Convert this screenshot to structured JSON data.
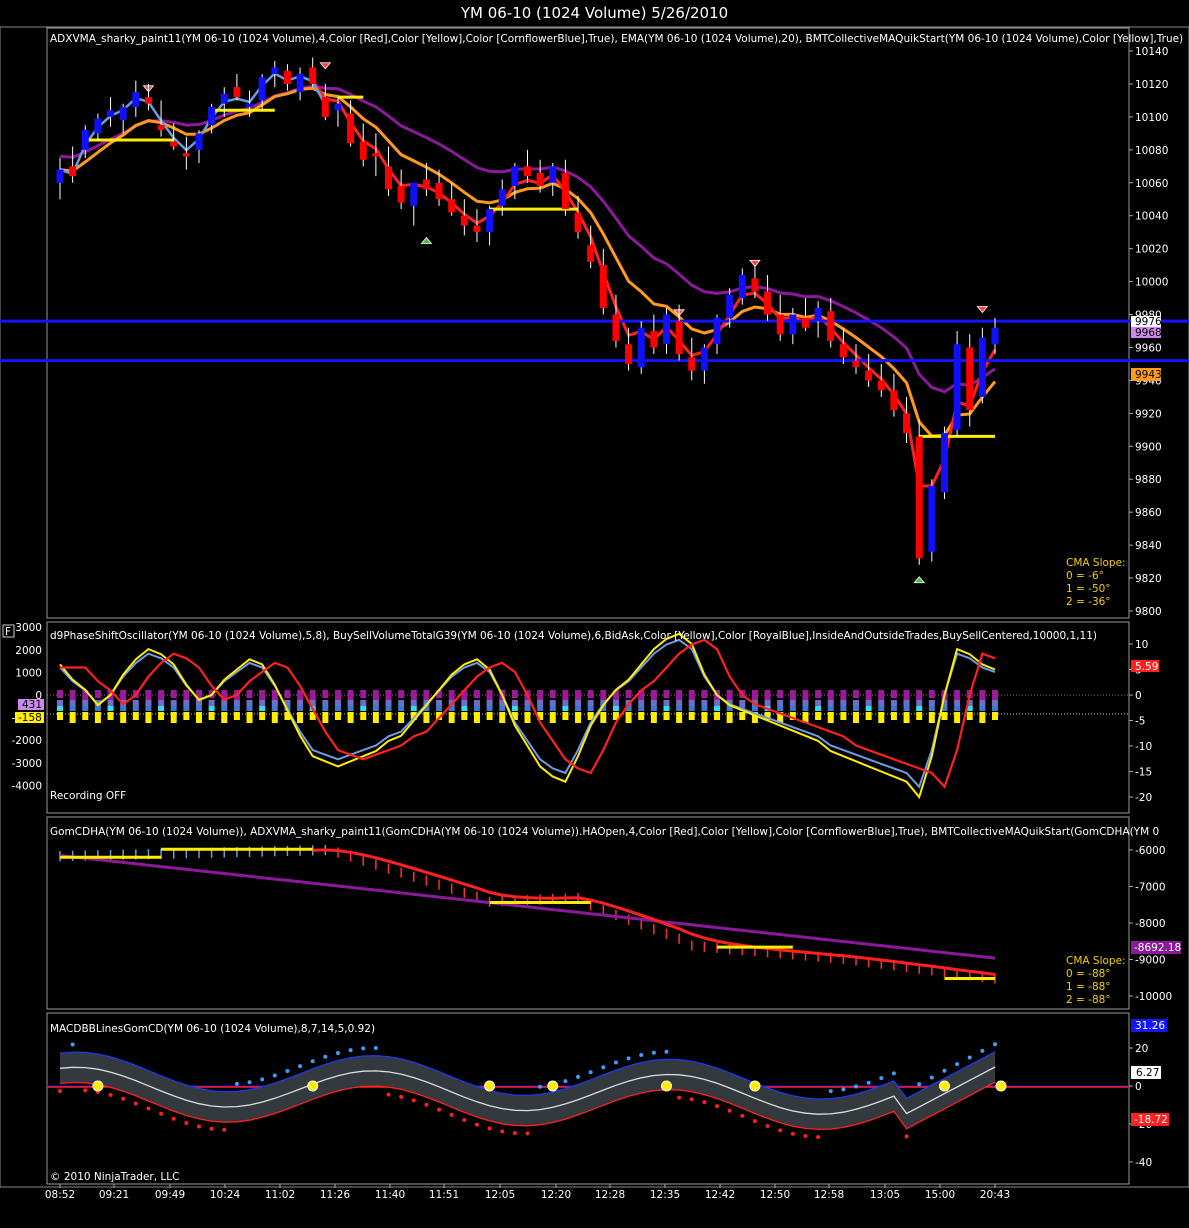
{
  "window": {
    "title": "YM 06-10 (1024 Volume)  5/26/2010"
  },
  "colors": {
    "bull": "#1010ff",
    "bear": "#ff0000",
    "cma": "#ff2020",
    "ema": "#ff9a1a",
    "slowma": "#8a1a9a",
    "adxvma": "#ffee00",
    "fast": "#6e9ae6",
    "hline": "#1414ff",
    "grid_border": "#9a9a9a"
  },
  "xaxis": {
    "labels": [
      "08:52",
      "09:21",
      "09:49",
      "10:24",
      "11:02",
      "11:26",
      "11:40",
      "11:51",
      "12:05",
      "12:20",
      "12:28",
      "12:35",
      "12:42",
      "12:50",
      "12:58",
      "13:05",
      "15:00",
      "20:43"
    ]
  },
  "footer": {
    "copyright": "© 2010 NinjaTrader, LLC"
  },
  "panels": [
    {
      "id": "price",
      "label": "ADXVMA_sharky_paint11(YM 06-10 (1024 Volume),4,Color [Red],Color [Yellow],Color [CornflowerBlue],True), EMA(YM 06-10 (1024 Volume),20), BMTCollectiveMAQuikStart(YM 06-10 (1024 Volume),Color [Yellow],True)",
      "ticks": [
        "10140",
        "10120",
        "10100",
        "10080",
        "10060",
        "10040",
        "10020",
        "10000",
        "9980",
        "9960",
        "9940",
        "9920",
        "9900",
        "9880",
        "9860",
        "9840",
        "9820",
        "9800"
      ],
      "badges": [
        {
          "text": "9976",
          "bg": "#ffffff",
          "fg": "#000000"
        },
        {
          "text": "9968",
          "bg": "#cc88ee",
          "fg": "#000000"
        },
        {
          "text": "9943",
          "bg": "#ff9a1a",
          "fg": "#000000"
        }
      ],
      "slope": {
        "title": "CMA Slope:",
        "lines": [
          "0 = -6°",
          "1 = -50°",
          "2 = -36°"
        ]
      }
    },
    {
      "id": "osc",
      "label": "d9PhaseShiftOscillator(YM 06-10 (1024 Volume),5,8), BuySellVolumeTotalG39(YM 06-10 (1024 Volume),6,BidAsk,Color [Yellow],Color [RoyalBlue],InsideAndOutsideTrades,BuySellCentered,10000,1,11)",
      "left_ticks": [
        "3000",
        "2000",
        "1000",
        "0",
        "-1000",
        "-2000",
        "-3000",
        "-4000"
      ],
      "right_ticks": [
        "10",
        "5",
        "0",
        "-5",
        "-10",
        "-15",
        "-20"
      ],
      "left_badges": [
        {
          "text": "431",
          "bg": "#cc88ee",
          "fg": "#000000"
        },
        {
          "text": "-158",
          "bg": "#ffee00",
          "fg": "#000000"
        }
      ],
      "right_badges": [
        {
          "text": "5.59",
          "bg": "#ff2020",
          "fg": "#ffffff"
        }
      ],
      "recording": "Recording OFF",
      "f_button": "F"
    },
    {
      "id": "gom",
      "label": "GomCDHA(YM 06-10 (1024 Volume)), ADXVMA_sharky_paint11(GomCDHA(YM 06-10 (1024 Volume)).HAOpen,4,Color [Red],Color [Yellow],Color [CornflowerBlue],True), BMTCollectiveMAQuikStart(GomCDHA(YM 0",
      "ticks": [
        "-6000",
        "-7000",
        "-8000",
        "-9000",
        "-10000"
      ],
      "badges": [
        {
          "text": "-8692.18",
          "bg": "#8a1a9a",
          "fg": "#ffffff"
        }
      ],
      "slope": {
        "title": "CMA Slope:",
        "lines": [
          "0 = -88°",
          "1 = -88°",
          "2 = -88°"
        ]
      }
    },
    {
      "id": "macd",
      "label": "MACDBBLinesGomCD(YM 06-10 (1024 Volume),8,7,14,5,0.92)",
      "ticks": [
        "20",
        "0",
        "-20",
        "-40"
      ],
      "badges": [
        {
          "text": "31.26",
          "bg": "#1414ff",
          "fg": "#ffffff"
        },
        {
          "text": "6.27",
          "bg": "#ffffff",
          "fg": "#000000"
        },
        {
          "text": "-18.72",
          "bg": "#ff2020",
          "fg": "#ffffff"
        }
      ]
    }
  ],
  "chart_data": [
    {
      "type": "candlestick",
      "panel": "price",
      "ylim": [
        9795,
        10150
      ],
      "series": [
        {
          "name": "ADXVMA_sharky_paint11",
          "values": []
        },
        {
          "name": "EMA(20)",
          "values": []
        },
        {
          "name": "BMTCollectiveMAQuikStart",
          "values": []
        }
      ],
      "ohlc": [
        [
          10060,
          10075,
          10050,
          10068
        ],
        [
          10070,
          10082,
          10060,
          10064
        ],
        [
          10080,
          10095,
          10075,
          10092
        ],
        [
          10090,
          10102,
          10085,
          10099
        ],
        [
          10100,
          10112,
          10094,
          10104
        ],
        [
          10098,
          10108,
          10090,
          10106
        ],
        [
          10106,
          10122,
          10100,
          10115
        ],
        [
          10112,
          10120,
          10104,
          10108
        ],
        [
          10095,
          10110,
          10088,
          10092
        ],
        [
          10085,
          10096,
          10080,
          10082
        ],
        [
          10078,
          10088,
          10068,
          10076
        ],
        [
          10080,
          10092,
          10072,
          10090
        ],
        [
          10095,
          10108,
          10090,
          10106
        ],
        [
          10108,
          10118,
          10100,
          10114
        ],
        [
          10118,
          10126,
          10110,
          10112
        ],
        [
          10106,
          10116,
          10100,
          10108
        ],
        [
          10110,
          10126,
          10104,
          10124
        ],
        [
          10126,
          10134,
          10118,
          10130
        ],
        [
          10128,
          10132,
          10116,
          10120
        ],
        [
          10115,
          10130,
          10110,
          10126
        ],
        [
          10130,
          10136,
          10118,
          10120
        ],
        [
          10112,
          10120,
          10098,
          10100
        ],
        [
          10104,
          10112,
          10094,
          10108
        ],
        [
          10102,
          10110,
          10082,
          10084
        ],
        [
          10085,
          10096,
          10070,
          10074
        ],
        [
          10078,
          10090,
          10064,
          10076
        ],
        [
          10070,
          10082,
          10052,
          10056
        ],
        [
          10058,
          10068,
          10044,
          10048
        ],
        [
          10046,
          10058,
          10034,
          10060
        ],
        [
          10062,
          10072,
          10052,
          10056
        ],
        [
          10060,
          10068,
          10046,
          10050
        ],
        [
          10050,
          10060,
          10040,
          10042
        ],
        [
          10040,
          10050,
          10028,
          10034
        ],
        [
          10034,
          10044,
          10024,
          10030
        ],
        [
          10030,
          10046,
          10022,
          10044
        ],
        [
          10046,
          10062,
          10040,
          10056
        ],
        [
          10058,
          10072,
          10050,
          10070
        ],
        [
          10070,
          10080,
          10060,
          10064
        ],
        [
          10066,
          10074,
          10054,
          10058
        ],
        [
          10060,
          10072,
          10052,
          10070
        ],
        [
          10066,
          10074,
          10040,
          10044
        ],
        [
          10042,
          10052,
          10026,
          10030
        ],
        [
          10022,
          10034,
          10008,
          10012
        ],
        [
          10010,
          10020,
          9980,
          9984
        ],
        [
          9980,
          9992,
          9960,
          9964
        ],
        [
          9962,
          9972,
          9946,
          9950
        ],
        [
          9948,
          9976,
          9944,
          9972
        ],
        [
          9970,
          9980,
          9956,
          9960
        ],
        [
          9962,
          9984,
          9956,
          9980
        ],
        [
          9976,
          9986,
          9952,
          9956
        ],
        [
          9954,
          9966,
          9940,
          9946
        ],
        [
          9946,
          9962,
          9938,
          9960
        ],
        [
          9962,
          9980,
          9956,
          9978
        ],
        [
          9978,
          9996,
          9972,
          9992
        ],
        [
          9990,
          10008,
          9986,
          10004
        ],
        [
          10002,
          10010,
          9990,
          9994
        ],
        [
          9994,
          10004,
          9976,
          9980
        ],
        [
          9980,
          9992,
          9964,
          9968
        ],
        [
          9968,
          9984,
          9962,
          9980
        ],
        [
          9978,
          9990,
          9970,
          9972
        ],
        [
          9976,
          9988,
          9966,
          9984
        ],
        [
          9982,
          9990,
          9960,
          9964
        ],
        [
          9962,
          9972,
          9950,
          9954
        ],
        [
          9952,
          9962,
          9944,
          9948
        ],
        [
          9946,
          9956,
          9936,
          9940
        ],
        [
          9940,
          9950,
          9930,
          9934
        ],
        [
          9934,
          9944,
          9918,
          9922
        ],
        [
          9920,
          9930,
          9902,
          9908
        ],
        [
          9906,
          9916,
          9828,
          9832
        ],
        [
          9836,
          9880,
          9830,
          9876
        ],
        [
          9872,
          9912,
          9868,
          9908
        ],
        [
          9910,
          9970,
          9906,
          9962
        ],
        [
          9960,
          9968,
          9912,
          9922
        ],
        [
          9930,
          9972,
          9926,
          9966
        ],
        [
          9962,
          9978,
          9956,
          9972
        ]
      ],
      "hlines": [
        9976,
        9952
      ]
    },
    {
      "type": "line+bar",
      "panel": "osc",
      "series": [
        {
          "name": "d9PhaseShiftOscillator",
          "values": []
        },
        {
          "name": "BuySellVolumeTotalG39",
          "values": []
        }
      ]
    },
    {
      "type": "heikin-ashi",
      "panel": "gom",
      "ylim": [
        -10200,
        -5700
      ],
      "series": [
        {
          "name": "GomCDHA",
          "values": []
        }
      ]
    },
    {
      "type": "line",
      "panel": "macd",
      "ylim": [
        -48,
        30
      ],
      "series": [
        {
          "name": "MACDBBLinesGomCD",
          "values": []
        }
      ]
    }
  ]
}
